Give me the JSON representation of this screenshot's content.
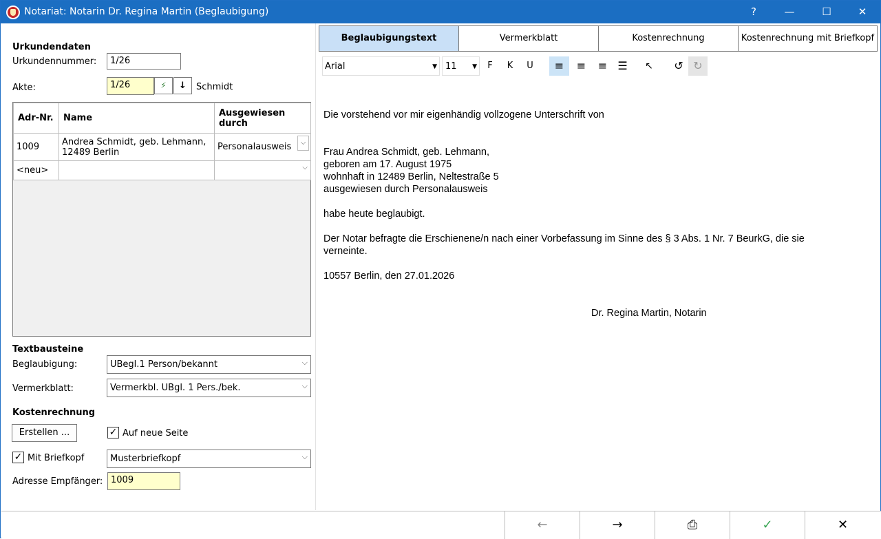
{
  "window": {
    "title": "Notariat: Notarin Dr. Regina Martin (Beglaubigung)",
    "controls": {
      "help": "?",
      "minimize": "—",
      "maximize": "☐",
      "close": "✕"
    }
  },
  "left": {
    "urkundendaten_heading": "Urkundendaten",
    "urkundennummer_label": "Urkundennummer:",
    "urkundennummer_value": "1/26",
    "akte_label": "Akte:",
    "akte_value": "1/26",
    "akte_name": "Schmidt",
    "table": {
      "headers": [
        "Adr-Nr.",
        "Name",
        "Ausgewiesen durch"
      ],
      "rows": [
        {
          "adr": "1009",
          "name_line1": "Andrea Schmidt, geb. Lehmann,",
          "name_line2": "12489 Berlin",
          "ausgewiesen": "Personalausweis"
        },
        {
          "adr": "<neu>",
          "name_line1": "",
          "name_line2": "",
          "ausgewiesen": ""
        }
      ]
    },
    "textbausteine_heading": "Textbausteine",
    "beglaubigung_label": "Beglaubigung:",
    "beglaubigung_value": "UBegl.1 Person/bekannt",
    "vermerkblatt_label": "Vermerkblatt:",
    "vermerkblatt_value": "Vermerkbl. UBgl. 1 Pers./bek.",
    "kostenrechnung_heading": "Kostenrechnung",
    "erstellen_button": "Erstellen ...",
    "auf_neue_seite_label": "Auf neue Seite",
    "auf_neue_seite_checked": true,
    "mit_briefkopf_label": "Mit Briefkopf",
    "mit_briefkopf_checked": true,
    "briefkopf_value": "Musterbriefkopf",
    "adresse_label": "Adresse Empfänger:",
    "adresse_value": "1009"
  },
  "tabs": [
    {
      "label": "Beglaubigungstext",
      "active": true
    },
    {
      "label": "Vermerkblatt",
      "active": false
    },
    {
      "label": "Kostenrechnung",
      "active": false
    },
    {
      "label": "Kostenrechnung mit Briefkopf",
      "active": false
    }
  ],
  "toolbar": {
    "font": "Arial",
    "size": "11",
    "bold": "F",
    "italic": "K",
    "underline": "U"
  },
  "document": {
    "line1": "Die vorstehend vor mir eigenhändig vollzogene Unterschrift von",
    "addr1": "Frau Andrea Schmidt, geb. Lehmann,",
    "addr2": "geboren am 17. August 1975",
    "addr3": "wohnhaft in 12489 Berlin, Neltestraße 5",
    "addr4": "ausgewiesen durch Personalausweis",
    "line2": "habe heute beglaubigt.",
    "line3a": "Der Notar befragte die Erschienene/n nach einer Vorbefassung im Sinne des § 3 Abs. 1 Nr. 7 BeurkG, die sie",
    "line3b": "verneinte.",
    "line4": "10557 Berlin, den 27.01.2026",
    "signature": "Dr. Regina Martin, Notarin"
  },
  "footer": {
    "back": "←",
    "forward": "→",
    "print": "⎙",
    "ok": "✓",
    "cancel": "✕"
  },
  "colors": {
    "titlebar": "#1b6ec2",
    "active_tab": "#c9e0f7",
    "yellow_field": "#ffffcc",
    "ok_green": "#3aa655"
  }
}
